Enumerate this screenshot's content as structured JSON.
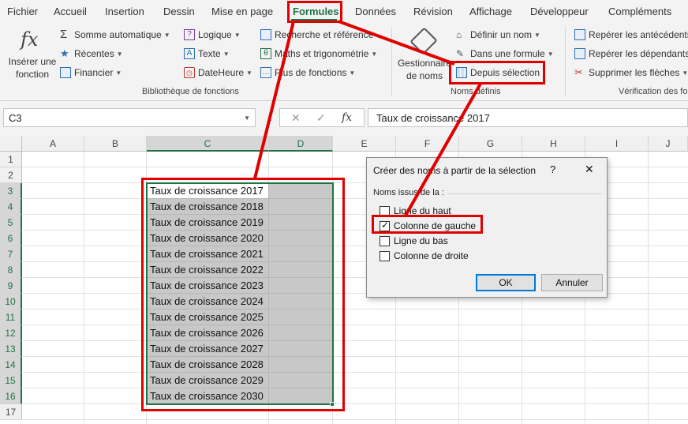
{
  "tabs": [
    "Fichier",
    "Accueil",
    "Insertion",
    "Dessin",
    "Mise en page",
    "Formules",
    "Données",
    "Révision",
    "Affichage",
    "Développeur",
    "Compléments"
  ],
  "ribbon": {
    "insert_function": {
      "line1": "Insérer une",
      "line2": "fonction",
      "symbol": "fx"
    },
    "library": {
      "autosum": "Somme automatique",
      "recent": "Récentes",
      "financial": "Financier",
      "logical": "Logique",
      "text": "Texte",
      "datetime": "DateHeure",
      "lookup": "Recherche et référence",
      "math": "Maths et trigonométrie",
      "more": "Plus de fonctions",
      "group_label": "Bibliothèque de fonctions"
    },
    "names": {
      "manager_line1": "Gestionnaire",
      "manager_line2": "de noms",
      "define": "Définir un nom",
      "use_in_formula": "Dans une formule",
      "from_selection": "Depuis sélection",
      "group_label": "Noms définis"
    },
    "audit": {
      "precedents": "Repérer les antécédents",
      "dependents": "Repérer les dépendants",
      "remove_arrows": "Supprimer les flèches",
      "group_label": "Vérification des fo"
    }
  },
  "formula_bar": {
    "name_box": "C3",
    "fx": "fx",
    "cancel": "✕",
    "enter": "✓",
    "content": "Taux de croissance 2017"
  },
  "grid": {
    "columns": [
      "A",
      "B",
      "C",
      "D",
      "E",
      "F",
      "G",
      "H",
      "I",
      "J"
    ],
    "rows": [
      "1",
      "2",
      "3",
      "4",
      "5",
      "6",
      "7",
      "8",
      "9",
      "10",
      "11",
      "12",
      "13",
      "14",
      "15",
      "16",
      "17"
    ],
    "cells_c": [
      "Taux de croissance 2017",
      "Taux de croissance 2018",
      "Taux de croissance 2019",
      "Taux de croissance 2020",
      "Taux de croissance 2021",
      "Taux de croissance 2022",
      "Taux de croissance 2023",
      "Taux de croissance 2024",
      "Taux de croissance 2025",
      "Taux de croissance 2026",
      "Taux de croissance 2027",
      "Taux de croissance 2028",
      "Taux de croissance 2029",
      "Taux de croissance 2030"
    ]
  },
  "dialog": {
    "title": "Créer des noms à partir de la sélection",
    "help": "?",
    "close": "✕",
    "group": "Noms issus de la :",
    "options": [
      {
        "label": "Ligne du haut",
        "checked": false
      },
      {
        "label": "Colonne de gauche",
        "checked": true
      },
      {
        "label": "Ligne du bas",
        "checked": false
      },
      {
        "label": "Colonne de droite",
        "checked": false
      }
    ],
    "ok": "OK",
    "cancel": "Annuler"
  },
  "colors": {
    "accent": "#217346",
    "annotation": "#e00000"
  }
}
